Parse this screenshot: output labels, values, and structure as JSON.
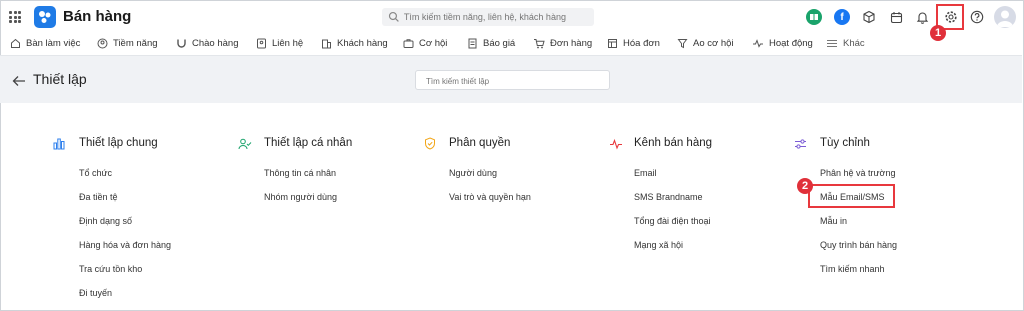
{
  "app": {
    "title": "Bán hàng"
  },
  "search": {
    "placeholder": "Tìm kiếm tiềm năng, liên hệ, khách hàng"
  },
  "topbar": {
    "facebook_letter": "f",
    "step1": "1"
  },
  "nav": [
    {
      "label": "Bàn làm việc",
      "icon": "home-icon"
    },
    {
      "label": "Tiềm năng",
      "icon": "user-circle-icon"
    },
    {
      "label": "Chào hàng",
      "icon": "magnet-icon"
    },
    {
      "label": "Liên hệ",
      "icon": "contact-icon"
    },
    {
      "label": "Khách hàng",
      "icon": "building-icon"
    },
    {
      "label": "Cơ hội",
      "icon": "briefcase-icon"
    },
    {
      "label": "Báo giá",
      "icon": "quote-icon"
    },
    {
      "label": "Đơn hàng",
      "icon": "cart-icon"
    },
    {
      "label": "Hóa đơn",
      "icon": "invoice-icon"
    },
    {
      "label": "Ao cơ hội",
      "icon": "funnel-icon"
    },
    {
      "label": "Hoạt động",
      "icon": "activity-icon"
    },
    {
      "label": "Khác",
      "icon": "menu-icon"
    }
  ],
  "header": {
    "title": "Thiết lập",
    "search_placeholder": "Tìm kiếm thiết lập"
  },
  "columns": [
    {
      "title": "Thiết lập chung",
      "icon": "bar-chart-icon",
      "items": [
        "Tổ chức",
        "Đa tiền tệ",
        "Định dạng số",
        "Hàng hóa và đơn hàng",
        "Tra cứu tồn kho",
        "Đi tuyến"
      ]
    },
    {
      "title": "Thiết lập cá nhân",
      "icon": "user-check-icon",
      "items": [
        "Thông tin cá nhân",
        "Nhóm người dùng"
      ]
    },
    {
      "title": "Phân quyền",
      "icon": "shield-icon",
      "items": [
        "Người dùng",
        "Vai trò và quyền hạn"
      ]
    },
    {
      "title": "Kênh bán hàng",
      "icon": "pulse-icon",
      "items": [
        "Email",
        "SMS Brandname",
        "Tổng đài điện thoại",
        "Mạng xã hội"
      ]
    },
    {
      "title": "Tùy chỉnh",
      "icon": "sliders-icon",
      "items": [
        "Phân hệ và trường",
        "Mẫu Email/SMS",
        "Mẫu in",
        "Quy trình bán hàng",
        "Tìm kiếm nhanh"
      ]
    }
  ],
  "annotations": {
    "step2": "2"
  },
  "colors": {
    "accent": "#1f7be6",
    "highlight": "#e8383d",
    "header_bg": "#f0f2f5"
  }
}
